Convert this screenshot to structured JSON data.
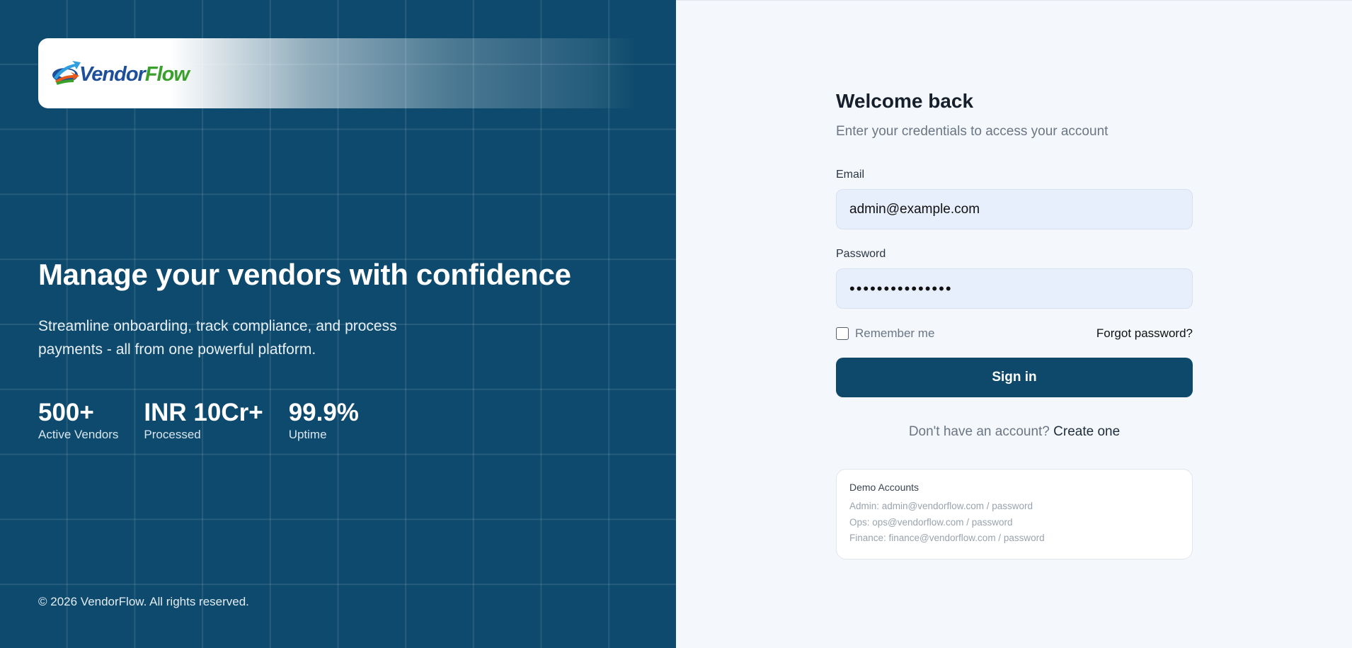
{
  "brand": {
    "logo_primary": "Vendor",
    "logo_secondary": "Flow",
    "logo_icon": "vendorflow-logo-icon"
  },
  "hero": {
    "title": "Manage your vendors with confidence",
    "subtitle": "Streamline onboarding, track compliance, and process payments - all from one powerful platform.",
    "stats": [
      {
        "value": "500+",
        "label": "Active Vendors"
      },
      {
        "value": "INR 10Cr+",
        "label": "Processed"
      },
      {
        "value": "99.9%",
        "label": "Uptime"
      }
    ],
    "copyright": "© 2026 VendorFlow. All rights reserved."
  },
  "login": {
    "title": "Welcome back",
    "subtitle": "Enter your credentials to access your account",
    "email_label": "Email",
    "email_value": "admin@example.com",
    "password_label": "Password",
    "password_value": "•••••••••••••••",
    "remember_label": "Remember me",
    "forgot_label": "Forgot password?",
    "signin_label": "Sign in",
    "signup_prompt": "Don't have an account?",
    "signup_link": "Create one"
  },
  "demo": {
    "title": "Demo Accounts",
    "accounts": [
      "Admin: admin@vendorflow.com / password",
      "Ops: ops@vendorflow.com / password",
      "Finance: finance@vendorflow.com / password"
    ]
  },
  "colors": {
    "hero_bg": "#0d4a6d",
    "primary_button": "#0e496b",
    "input_bg": "#e8effc",
    "panel_bg": "#f4f7fb"
  }
}
